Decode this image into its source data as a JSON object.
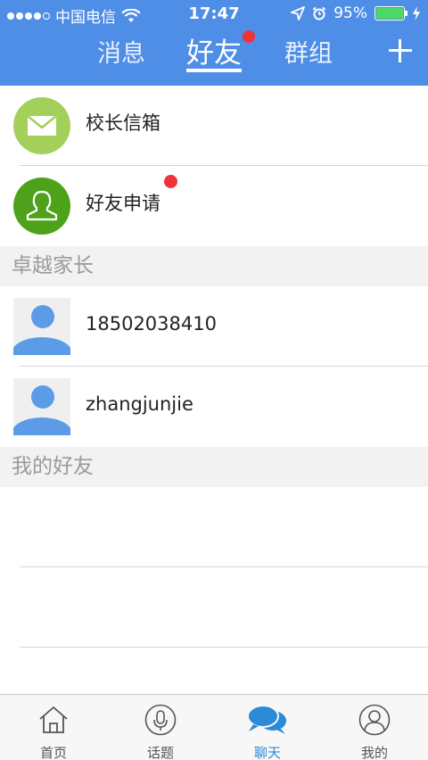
{
  "status_bar": {
    "carrier": "中国电信",
    "time": "17:47",
    "battery": "95%"
  },
  "nav": {
    "tabs": [
      {
        "label": "消息"
      },
      {
        "label": "好友"
      },
      {
        "label": "群组"
      }
    ],
    "active_index": 1,
    "add_icon": "plus-icon"
  },
  "list": {
    "top_items": [
      {
        "label": "校长信箱",
        "icon": "mail-icon",
        "color": "#a3d05a"
      },
      {
        "label": "好友申请",
        "icon": "person-icon",
        "color": "#4ea21b",
        "badge": true
      }
    ],
    "sections": [
      {
        "title": "卓越家长",
        "items": [
          {
            "label": "18502038410"
          },
          {
            "label": "zhangjunjie"
          }
        ]
      },
      {
        "title": "我的好友"
      }
    ]
  },
  "tabbar": {
    "items": [
      {
        "label": "首页",
        "icon": "home-icon"
      },
      {
        "label": "话题",
        "icon": "microphone-icon"
      },
      {
        "label": "聊天",
        "icon": "chat-bubbles-icon"
      },
      {
        "label": "我的",
        "icon": "profile-icon"
      }
    ],
    "active_index": 2,
    "active_color": "#2b8bd8"
  },
  "colors": {
    "header": "#4f8ee6",
    "badge": "#f0333b"
  }
}
